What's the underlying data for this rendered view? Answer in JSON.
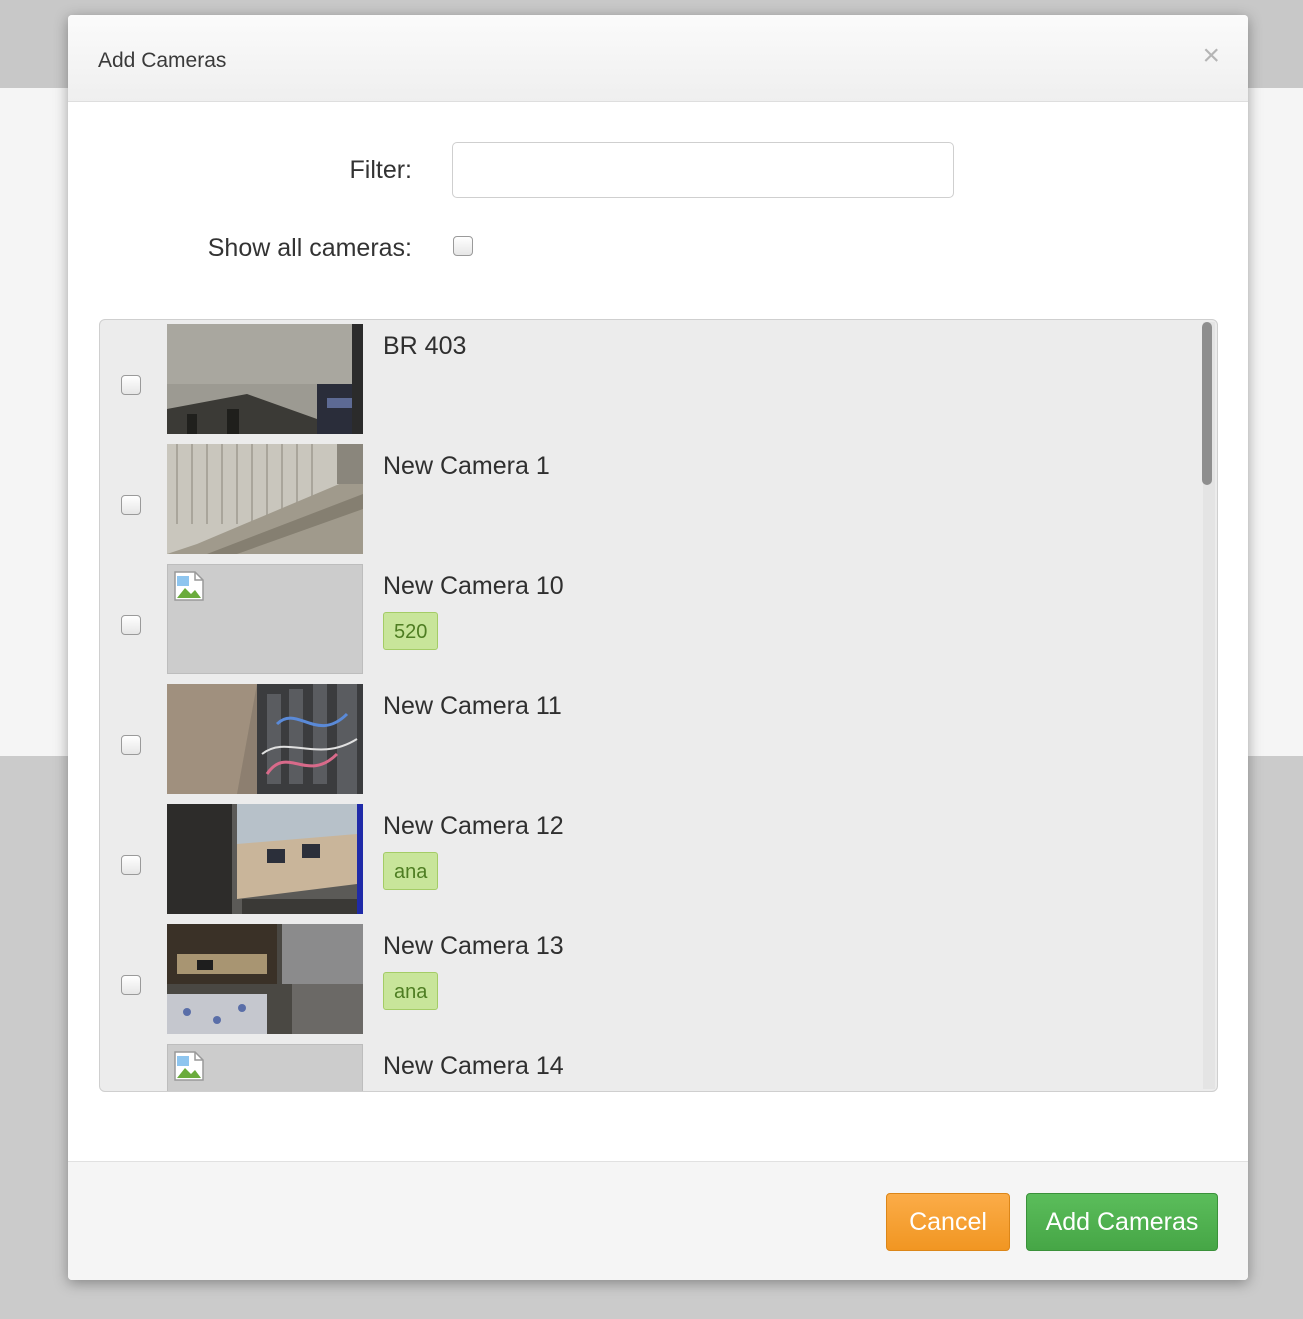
{
  "modal": {
    "title": "Add Cameras",
    "close_glyph": "×"
  },
  "filter": {
    "label": "Filter:",
    "value": "",
    "placeholder": ""
  },
  "show_all": {
    "label": "Show all cameras:",
    "checked": false
  },
  "cameras": [
    {
      "name": "BR 403",
      "tag": null,
      "thumbnail": "office-floor-image",
      "checked": false
    },
    {
      "name": "New Camera 1",
      "tag": null,
      "thumbnail": "stairwell-image",
      "checked": false
    },
    {
      "name": "New Camera 10",
      "tag": "520",
      "thumbnail": "broken-image-icon",
      "checked": false
    },
    {
      "name": "New Camera 11",
      "tag": null,
      "thumbnail": "server-room-image",
      "checked": false
    },
    {
      "name": "New Camera 12",
      "tag": "ana",
      "thumbnail": "office-desks-image",
      "checked": false
    },
    {
      "name": "New Camera 13",
      "tag": "ana",
      "thumbnail": "workspace-image",
      "checked": false
    },
    {
      "name": "New Camera 14",
      "tag": null,
      "thumbnail": "broken-image-icon",
      "checked": false
    }
  ],
  "footer": {
    "cancel_label": "Cancel",
    "add_label": "Add Cameras"
  },
  "colors": {
    "cancel": "#f19622",
    "add": "#46a646",
    "tag_bg": "#c8e59a",
    "tag_text": "#4e7d22"
  }
}
